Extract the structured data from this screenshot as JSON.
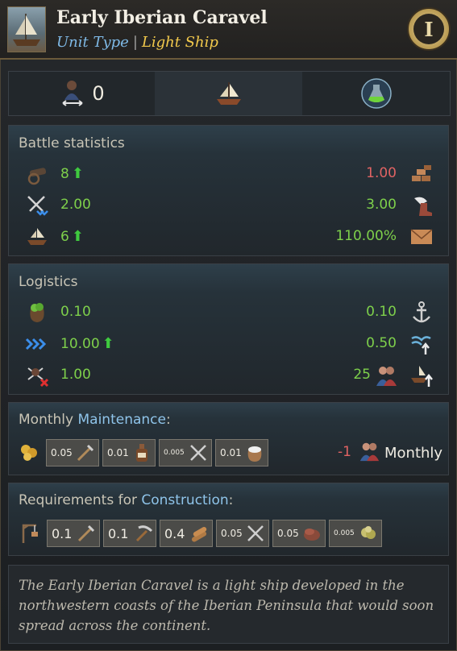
{
  "header": {
    "title": "Early Iberian Caravel",
    "unit_type_label": "Unit Type",
    "separator": "|",
    "category": "Light Ship",
    "age_numeral": "I"
  },
  "iconbar": {
    "crew_count": "0",
    "icons": [
      "crew-transfer-icon",
      "ship-icon",
      "potion-flask-icon"
    ]
  },
  "battle": {
    "title": "Battle statistics",
    "rows": [
      {
        "left_icon": "cannon-icon",
        "left": "8",
        "left_up": true,
        "right": "1.00",
        "right_color": "red",
        "right_icon": "bricks-icon"
      },
      {
        "left_icon": "crossed-swords-icon",
        "left": "2.00",
        "left_up": false,
        "right": "3.00",
        "right_color": "green",
        "right_icon": "winged-boot-icon"
      },
      {
        "left_icon": "ship-boarding-icon",
        "left": "6",
        "left_up": true,
        "right": "110.00%",
        "right_color": "green",
        "right_icon": "envelope-icon"
      }
    ]
  },
  "logistics": {
    "title": "Logistics",
    "rows": [
      {
        "left_icon": "food-sack-icon",
        "left": "0.10",
        "left_up": false,
        "right": "0.10",
        "right_icon": "anchor-icon"
      },
      {
        "left_icon": "speed-chevrons-icon",
        "left": "10.00",
        "left_up": true,
        "right": "0.50",
        "right_icon": "waves-up-icon"
      },
      {
        "left_icon": "pirate-cancel-icon",
        "left": "1.00",
        "left_up": false,
        "right": "25",
        "right_icon": "ship-up-icon",
        "right_extra_icon": "sailors-icon"
      }
    ]
  },
  "maintenance": {
    "title_prefix": "Monthly ",
    "title_link": "Maintenance",
    "title_suffix": ":",
    "items": [
      {
        "amount": "0.05",
        "icon": "tools-icon"
      },
      {
        "amount": "0.01",
        "icon": "liquor-bottle-icon"
      },
      {
        "amount": "0.005",
        "icon": "weapons-icon"
      },
      {
        "amount": "0.01",
        "icon": "salt-sack-icon"
      }
    ],
    "pop_cost": "-1",
    "monthly_label": "Monthly"
  },
  "construction": {
    "title_prefix": "Requirements for ",
    "title_link": "Construction",
    "title_suffix": ":",
    "items": [
      {
        "amount": "0.1",
        "icon": "tools-icon"
      },
      {
        "amount": "0.1",
        "icon": "pickaxe-icon"
      },
      {
        "amount": "0.4",
        "icon": "lumber-icon"
      },
      {
        "amount": "0.05",
        "icon": "weapons-icon"
      },
      {
        "amount": "0.05",
        "icon": "leather-icon"
      },
      {
        "amount": "0.005",
        "icon": "fiber-icon"
      }
    ]
  },
  "description": "The Early Iberian Caravel is a light ship developed in the northwestern coasts of the Iberian Peninsula that would soon spread across the continent.",
  "colors": {
    "positive": "#7ed04b",
    "negative": "#e06363",
    "link": "#8fc4ea",
    "category": "#f2c94c"
  }
}
